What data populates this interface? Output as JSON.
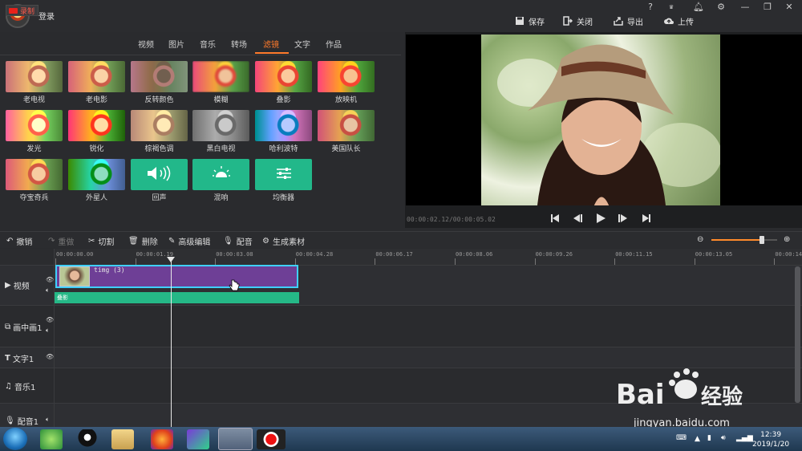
{
  "header": {
    "login": "登录",
    "buttons": [
      {
        "label": "保存",
        "icon": "save-icon"
      },
      {
        "label": "关闭",
        "icon": "close-icon"
      },
      {
        "label": "导出",
        "icon": "export-icon"
      },
      {
        "label": "上传",
        "icon": "upload-icon"
      }
    ],
    "window": [
      "?",
      "VIP",
      "bell",
      "gear",
      "minimize",
      "maximize",
      "close"
    ]
  },
  "left": {
    "record": "录制",
    "tabs": [
      "视频",
      "图片",
      "音乐",
      "转场",
      "滤镜",
      "文字",
      "作品"
    ],
    "active_tab": "滤镜",
    "filters": [
      "老电视",
      "老电影",
      "反转颜色",
      "模糊",
      "叠影",
      "放映机",
      "发光",
      "锐化",
      "棕褐色调",
      "黑白电视",
      "哈利波特",
      "美国队长",
      "夺宝奇兵",
      "外星人",
      "回声",
      "混响",
      "均衡器"
    ]
  },
  "preview": {
    "timecode": "00:00:02.12/00:00:05.02"
  },
  "toolbar": {
    "undo": "撤销",
    "redo": "重做",
    "cut": "切割",
    "delete": "删除",
    "advanced": "高级编辑",
    "dub": "配音",
    "generate": "生成素材",
    "zoom_level": 0.78
  },
  "timeline": {
    "ticks": [
      "00:00:00.00",
      "00:00:01.19",
      "00:00:03.08",
      "00:00:04.28",
      "00:00:06.17",
      "00:00:08.06",
      "00:00:09.26",
      "00:00:11.15",
      "00:00:13.05",
      "00:00:14"
    ],
    "tracks": [
      "视频",
      "画中画1",
      "文字1",
      "音乐1",
      "配音1"
    ],
    "clip_label": "timg (3)",
    "filter_label": "叠影"
  },
  "taskbar": {
    "time": "12:39",
    "date": "2019/1/20"
  },
  "watermark": {
    "brand": "Bai",
    "brand2": "du",
    "brand_cn": "经验",
    "url": "jingyan.baidu.com"
  },
  "colors": {
    "accent": "#ff7a2b",
    "clip": "#6e3f96",
    "filter": "#25b887",
    "selection": "#3fd0ff"
  }
}
